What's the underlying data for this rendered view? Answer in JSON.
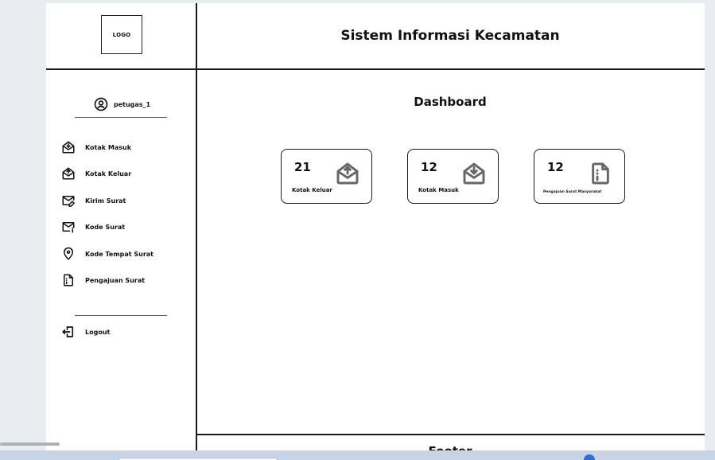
{
  "header": {
    "logo_text": "LOGO",
    "app_title": "Sistem Informasi Kecamatan"
  },
  "sidebar": {
    "user": {
      "name": "petugas_1",
      "icon": "user-circle-icon"
    },
    "menu": [
      {
        "label": "Kotak Masuk",
        "icon": "inbox-download-icon"
      },
      {
        "label": "Kotak Keluar",
        "icon": "inbox-upload-icon"
      },
      {
        "label": "Kirim Surat",
        "icon": "mail-edit-icon"
      },
      {
        "label": "Kode Surat",
        "icon": "mail-info-icon"
      },
      {
        "label": "Kode Tempat Surat",
        "icon": "map-pin-icon"
      },
      {
        "label": "Pengajuan Surat",
        "icon": "document-icon"
      }
    ],
    "logout": {
      "label": "Logout",
      "icon": "logout-icon"
    }
  },
  "main": {
    "title": "Dashboard",
    "cards": [
      {
        "count": "21",
        "label": "Kotak Keluar",
        "icon": "inbox-upload-icon"
      },
      {
        "count": "12",
        "label": "Kotak Masuk",
        "icon": "inbox-download-icon"
      },
      {
        "count": "12",
        "label": "Pengajuan Surat Masyarakat",
        "icon": "document-icon"
      }
    ]
  },
  "footer": {
    "text": "Footer"
  }
}
